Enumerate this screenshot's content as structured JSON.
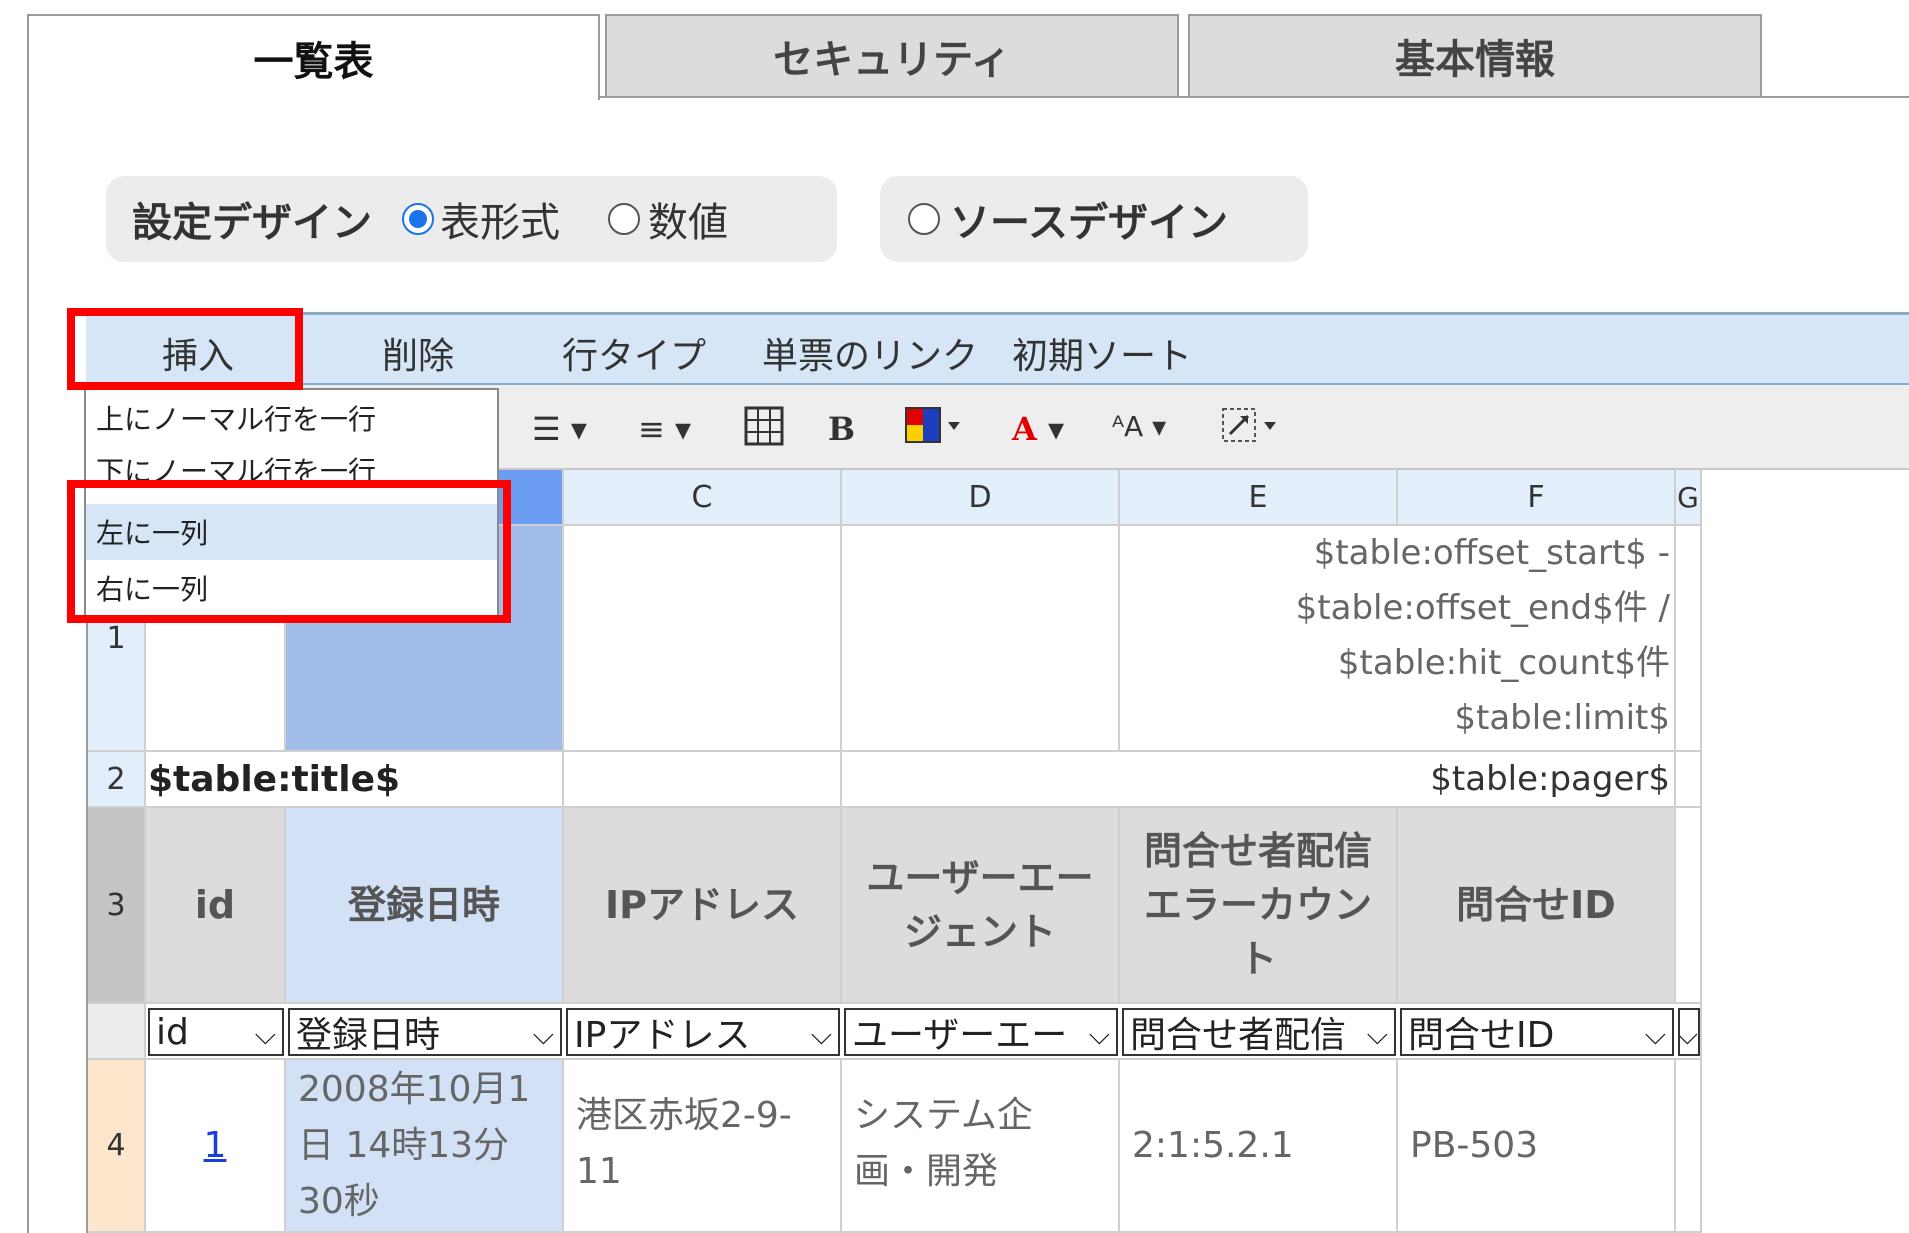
{
  "tabs": [
    {
      "label": "一覧表",
      "active": true
    },
    {
      "label": "セキュリティ",
      "active": false
    },
    {
      "label": "基本情報",
      "active": false
    }
  ],
  "mode": {
    "setting_label": "設定デザイン",
    "table_format_label": "表形式",
    "numeric_label": "数値",
    "source_design_label": "ソースデザイン",
    "selected": "表形式"
  },
  "menu": {
    "insert": "挿入",
    "delete": "削除",
    "row_type": "行タイプ",
    "form_link": "単票のリンク",
    "initial_sort": "初期ソート"
  },
  "insert_menu": {
    "items": [
      "上にノーマル行を一行",
      "下にノーマル行を一行",
      "左に一列",
      "右に一列"
    ],
    "highlighted": "左に一列"
  },
  "toolbar": {
    "bold": "B",
    "font_color": "A",
    "dropdown_arrow": "▾",
    "icons": [
      "align-vertical-icon",
      "align-horizontal-icon",
      "border-grid-icon",
      "bold-icon",
      "fill-color-icon",
      "font-color-icon",
      "font-size-icon",
      "resize-icon"
    ]
  },
  "grid": {
    "columns": [
      "C",
      "D",
      "E",
      "F",
      "G"
    ],
    "row_numbers": [
      "1",
      "2",
      "3",
      "4"
    ],
    "row1_text": [
      "$table:offset_start$ -",
      "$table:offset_end$件 /",
      "$table:hit_count$件",
      "$table:limit$"
    ],
    "row2_title": "$table:title$",
    "row2_pager": "$table:pager$",
    "headers": [
      "id",
      "登録日時",
      "IPアドレス",
      "ユーザーエージェント",
      "問合せ者配信エラーカウント",
      "問合せID"
    ],
    "header_lines": {
      "user_agent": [
        "ユーザーエー",
        "ジェント"
      ],
      "error_count": [
        "問合せ者配信",
        "エラーカウン",
        "ト"
      ]
    },
    "field_selects": [
      "id",
      "登録日時",
      "IPアドレス",
      "ユーザーエー",
      "問合せ者配信",
      "問合せID"
    ],
    "row4": {
      "id_link": "1",
      "date_lines": [
        "2008年10月1",
        "日 14時13分",
        "30秒"
      ],
      "address_lines": [
        "港区赤坂2-9-",
        "11"
      ],
      "user_agent_lines": [
        "システム企",
        "画・開発"
      ],
      "error_count": "2:1:5.2.1",
      "inquiry_id": "PB-503"
    }
  },
  "colors": {
    "accent": "#1a73e8",
    "highlight_red": "#ff0000",
    "menubar_bg": "#d6e6f6",
    "selected_column": "#a3bdeb",
    "header_bg": "#dcdcdc"
  }
}
